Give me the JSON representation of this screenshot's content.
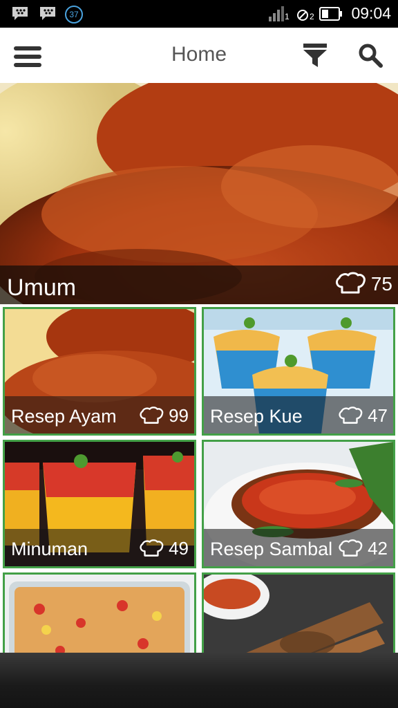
{
  "status_bar": {
    "time": "09:04",
    "notification_count": "37",
    "sim_label_1": "1",
    "sim_label_2": "2",
    "icons": [
      "bbm-icon",
      "bbm-icon",
      "notification-count-badge",
      "signal-icon",
      "no-sim-icon",
      "battery-icon"
    ]
  },
  "app_bar": {
    "title": "Home",
    "icons": [
      "menu-icon",
      "filter-icon",
      "search-icon"
    ],
    "accent": "#43a047"
  },
  "hero": {
    "label": "Umum",
    "count": "75",
    "icon": "chef-hat-icon"
  },
  "categories": [
    {
      "label": "Resep Ayam",
      "count": "99",
      "icon": "chef-hat-icon"
    },
    {
      "label": "Resep Kue",
      "count": "47",
      "icon": "chef-hat-icon"
    },
    {
      "label": "Minuman",
      "count": "49",
      "icon": "chef-hat-icon"
    },
    {
      "label": "Resep Sambal",
      "count": "42",
      "icon": "chef-hat-icon"
    },
    {
      "label": "",
      "count": "",
      "icon": "chef-hat-icon"
    },
    {
      "label": "",
      "count": "",
      "icon": "chef-hat-icon"
    }
  ],
  "colors": {
    "tile_border": "#43a047",
    "status_bar_bg": "#000000",
    "app_bar_bg": "#ffffff",
    "title_text": "#555555"
  }
}
